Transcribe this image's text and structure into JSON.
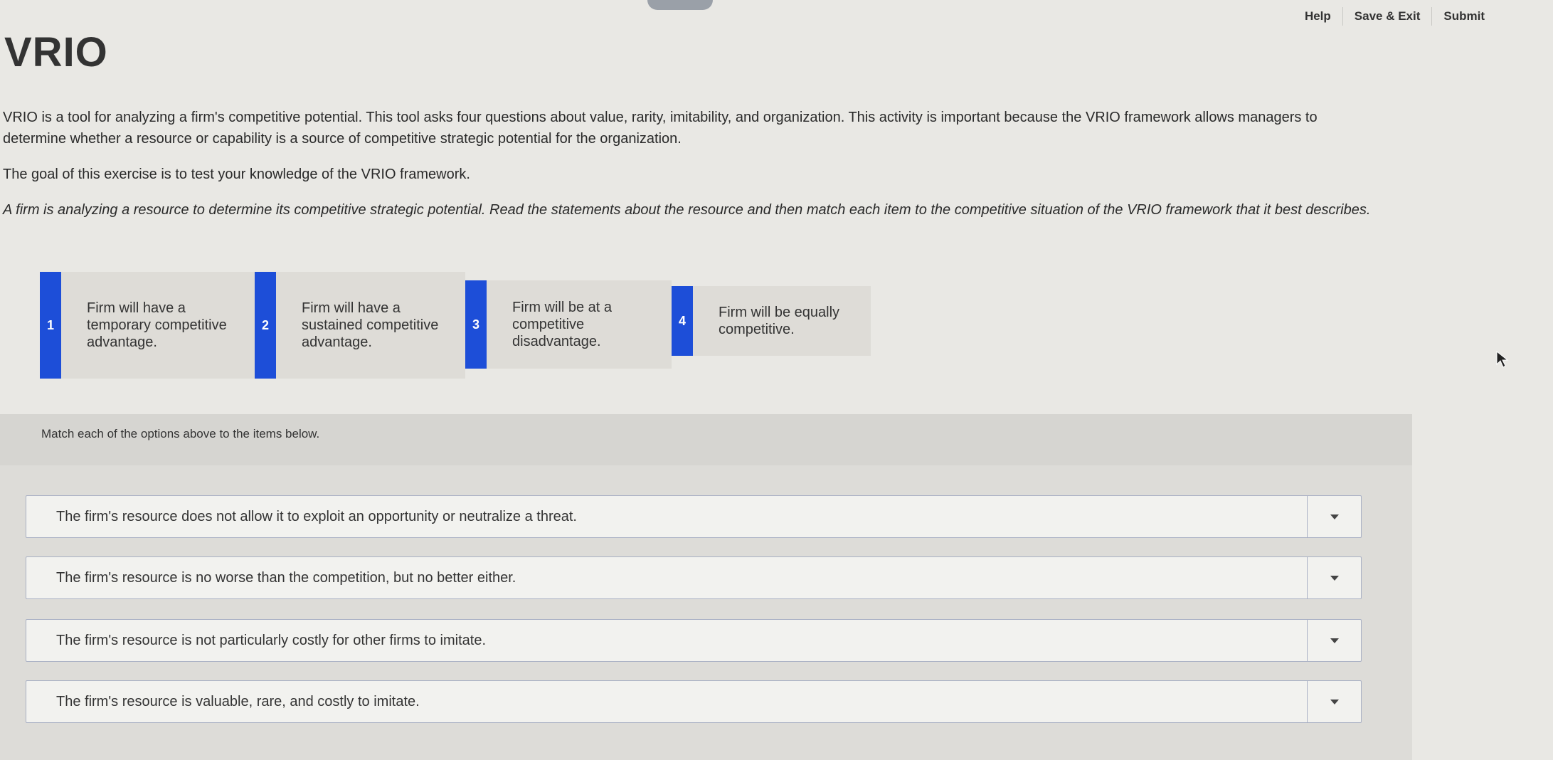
{
  "header": {
    "nav": [
      "Help",
      "Save & Exit",
      "Submit"
    ]
  },
  "page": {
    "title": "VRIO",
    "intro": [
      "VRIO is a tool for analyzing a firm's competitive potential. This tool asks four questions about value, rarity, imitability, and organization. This activity is important because the VRIO framework allows managers to determine whether a resource or capability is a source of competitive strategic potential for the organization.",
      "The goal of this exercise is to test your knowledge of the VRIO framework."
    ],
    "task": "A firm is analyzing a resource to determine its competitive strategic potential. Read the statements about the resource and then match each item to the competitive situation of the VRIO framework that it best describes."
  },
  "options": [
    {
      "num": "1",
      "text": "Firm will have a temporary competitive advantage."
    },
    {
      "num": "2",
      "text": "Firm will have a sustained competitive advantage."
    },
    {
      "num": "3",
      "text": "Firm will be at a competitive disadvantage."
    },
    {
      "num": "4",
      "text": "Firm will be equally competitive."
    }
  ],
  "match": {
    "instructions": "Match each of the options above to the items below.",
    "items": [
      "The firm's resource does not allow it to exploit an opportunity or neutralize a threat.",
      "The firm's resource is no worse than the competition, but no better either.",
      "The firm's resource is not particularly costly for other firms to imitate.",
      "The firm's resource is valuable, rare, and costly to imitate."
    ]
  },
  "colors": {
    "accent": "#1d4ed8",
    "background": "#e9e8e4"
  }
}
